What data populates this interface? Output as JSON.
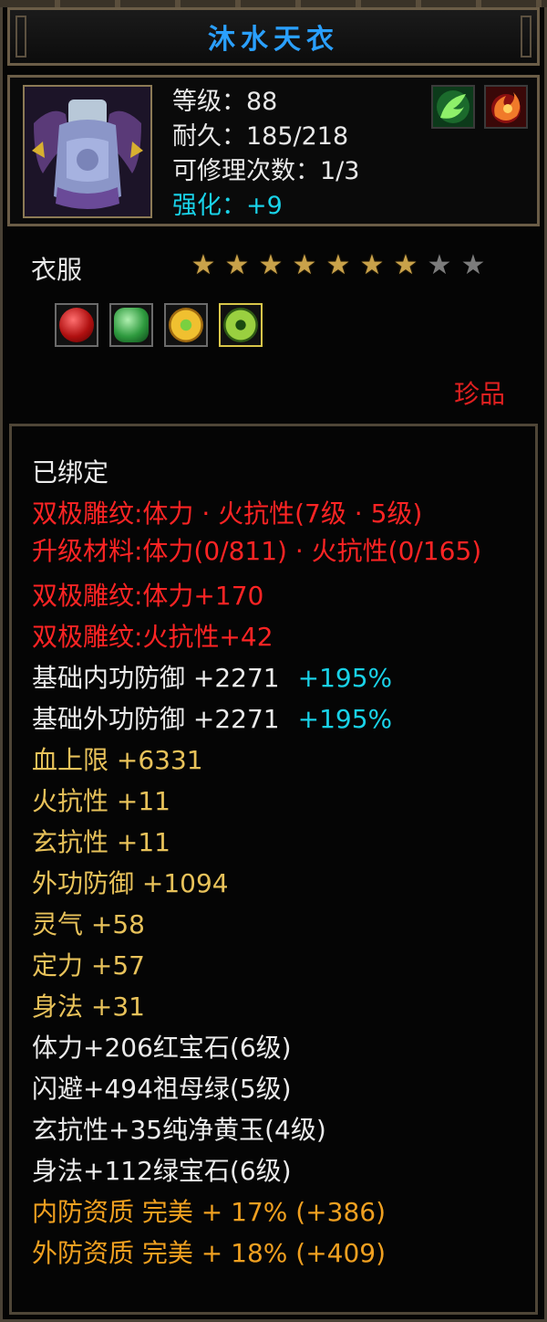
{
  "title": "沐水天衣",
  "info": {
    "level_label": "等级：",
    "level": "88",
    "durability_label": "耐久：",
    "durability": "185/218",
    "repairs_label": "可修理次数：",
    "repairs": "1/3",
    "enhance_label": "强化：",
    "enhance": "+9",
    "skill_icons": [
      "green-leaf-skill-icon",
      "fire-swirl-skill-icon"
    ]
  },
  "item_type": "衣服",
  "stars": {
    "filled": 7,
    "total": 9
  },
  "gems": [
    {
      "name": "ruby-gem-icon",
      "color": "#c01818",
      "selected": false
    },
    {
      "name": "emerald-gem-icon",
      "color": "#2e9a3e",
      "selected": false
    },
    {
      "name": "yellow-jade-gem-icon",
      "color": "#d9a21c",
      "selected": false
    },
    {
      "name": "green-gem-icon",
      "color": "#6bb82a",
      "selected": true
    }
  ],
  "rarity": "珍品",
  "details": {
    "bound": "已绑定",
    "engrave_1": "双极雕纹:体力 · 火抗性(7级 · 5级)",
    "upgrade_mat": "升级材料:体力(0/811) · 火抗性(0/165)",
    "engrave_2": "双极雕纹:体力+170",
    "engrave_3": "双极雕纹:火抗性+42",
    "base_inner_def_label": "基础内功防御  +2271",
    "base_inner_def_pct": "+195%",
    "base_outer_def_label": "基础外功防御  +2271",
    "base_outer_def_pct": "+195%",
    "hp": "血上限  +6331",
    "fire_res": "火抗性  +11",
    "xuan_res": "玄抗性  +11",
    "outer_def": "外功防御  +1094",
    "lingqi": "灵气  +58",
    "dingli": "定力  +57",
    "shenfa": "身法  +31",
    "gem_1": "体力+206红宝石(6级)",
    "gem_2": "闪避+494祖母绿(5级)",
    "gem_3": "玄抗性+35纯净黄玉(4级)",
    "gem_4": "身法+112绿宝石(6级)",
    "quality_inner": "内防资质  完美  +  17%  (+386)",
    "quality_outer": "外防资质  完美  +  18%  (+409)"
  },
  "colors": {
    "title": "#2aa0ff",
    "cyan": "#19d2e8",
    "red": "#ff2424",
    "gold": "#e8c25a",
    "orange": "#f0a020"
  }
}
